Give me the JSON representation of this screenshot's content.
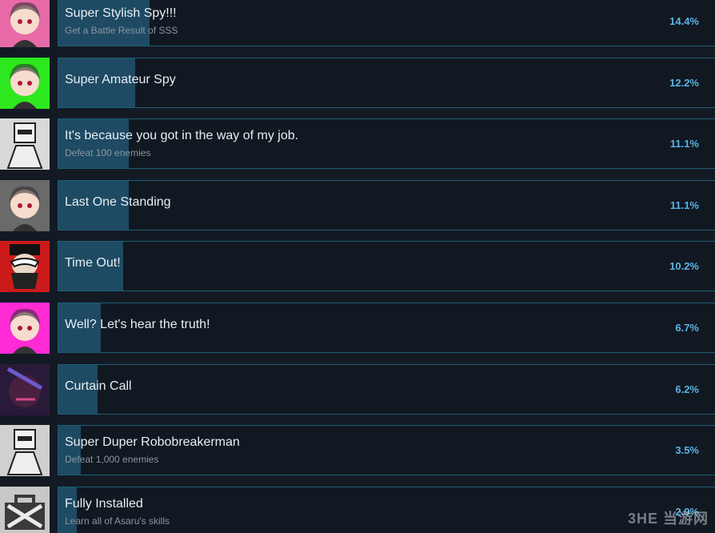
{
  "achievements": [
    {
      "title": "Super Stylish Spy!!!",
      "description": "Get a Battle Result of SSS",
      "percent_label": "14.4%",
      "percent": 14.4,
      "icon": "pink-hair-girl-avatar-icon",
      "icon_bg": "#e86aa8"
    },
    {
      "title": "Super Amateur Spy",
      "description": "",
      "percent_label": "12.2%",
      "percent": 12.2,
      "icon": "blonde-hat-girl-avatar-icon",
      "icon_bg": "#2ee81f"
    },
    {
      "title": "It's because you got in the way of my job.",
      "description": "Defeat 100 enemies",
      "percent_label": "11.1%",
      "percent": 11.1,
      "icon": "robot-mask-avatar-icon",
      "icon_bg": "#d9d9d9"
    },
    {
      "title": "Last One Standing",
      "description": "",
      "percent_label": "11.1%",
      "percent": 11.1,
      "icon": "dark-hair-girl-avatar-icon",
      "icon_bg": "#6a6a6a"
    },
    {
      "title": "Time Out!",
      "description": "",
      "percent_label": "10.2%",
      "percent": 10.2,
      "icon": "masked-villain-avatar-icon",
      "icon_bg": "#cc1a1a"
    },
    {
      "title": "Well? Let's hear the truth!",
      "description": "",
      "percent_label": "6.7%",
      "percent": 6.7,
      "icon": "white-hair-girl-avatar-icon",
      "icon_bg": "#ff2bd4"
    },
    {
      "title": "Curtain Call",
      "description": "",
      "percent_label": "6.2%",
      "percent": 6.2,
      "icon": "dark-shadow-avatar-icon",
      "icon_bg": "#2a1a3a"
    },
    {
      "title": "Super Duper Robobreakerman",
      "description": "Defeat 1,000 enemies",
      "percent_label": "3.5%",
      "percent": 3.5,
      "icon": "white-robot-avatar-icon",
      "icon_bg": "#d0d0d0"
    },
    {
      "title": "Fully Installed",
      "description": "Learn all of Asaru's skills",
      "percent_label": "2.9%",
      "percent": 2.9,
      "icon": "toolbox-icon",
      "icon_bg": "#c8c8c8"
    }
  ],
  "watermark": "3HE 当游网",
  "colors": {
    "background": "#131a24",
    "bar": "#1e4a63",
    "border": "#1c5f72",
    "percent_text": "#5bb4e6"
  }
}
